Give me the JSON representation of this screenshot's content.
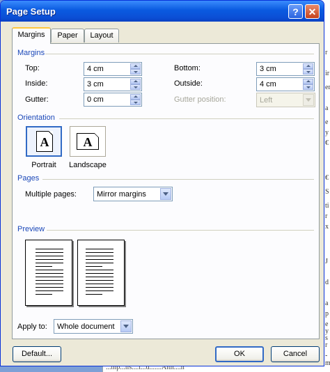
{
  "window": {
    "title": "Page Setup"
  },
  "tabs": [
    {
      "label": "Margins",
      "selected": true
    },
    {
      "label": "Paper",
      "selected": false
    },
    {
      "label": "Layout",
      "selected": false
    }
  ],
  "margins": {
    "header": "Margins",
    "top": {
      "label": "Top:",
      "value": "4 cm"
    },
    "inside": {
      "label": "Inside:",
      "value": "3 cm"
    },
    "gutter": {
      "label": "Gutter:",
      "value": "0 cm"
    },
    "bottom": {
      "label": "Bottom:",
      "value": "3 cm"
    },
    "outside": {
      "label": "Outside:",
      "value": "4 cm"
    },
    "gutter_position": {
      "label": "Gutter position:",
      "value": "Left",
      "disabled": true
    }
  },
  "orientation": {
    "header": "Orientation",
    "portrait": {
      "label": "Portrait",
      "glyph": "A",
      "selected": true
    },
    "landscape": {
      "label": "Landscape",
      "glyph": "A",
      "selected": false
    }
  },
  "pages": {
    "header": "Pages",
    "multiple_pages": {
      "label": "Multiple pages:",
      "value": "Mirror margins"
    }
  },
  "preview": {
    "header": "Preview"
  },
  "apply_to": {
    "label": "Apply to:",
    "value": "Whole document"
  },
  "buttons": {
    "default": "Default...",
    "ok": "OK",
    "cancel": "Cancel"
  },
  "background_doc": {
    "fragments": [
      "r",
      "ir",
      "er",
      "a",
      "e",
      "y",
      "€",
      "€",
      "S",
      "ti",
      "r",
      "x",
      "J",
      "d",
      "a",
      "p",
      "e",
      "y",
      "s",
      "r",
      "-mm"
    ],
    "bottom_text": "...mp...lis....t...d.......Alth....h"
  },
  "colors": {
    "title_bar": "#0a5ae0",
    "group_header": "#1a47b8",
    "dialog_bg": "#ece9d8",
    "tab_accent": "#ffc73c"
  }
}
